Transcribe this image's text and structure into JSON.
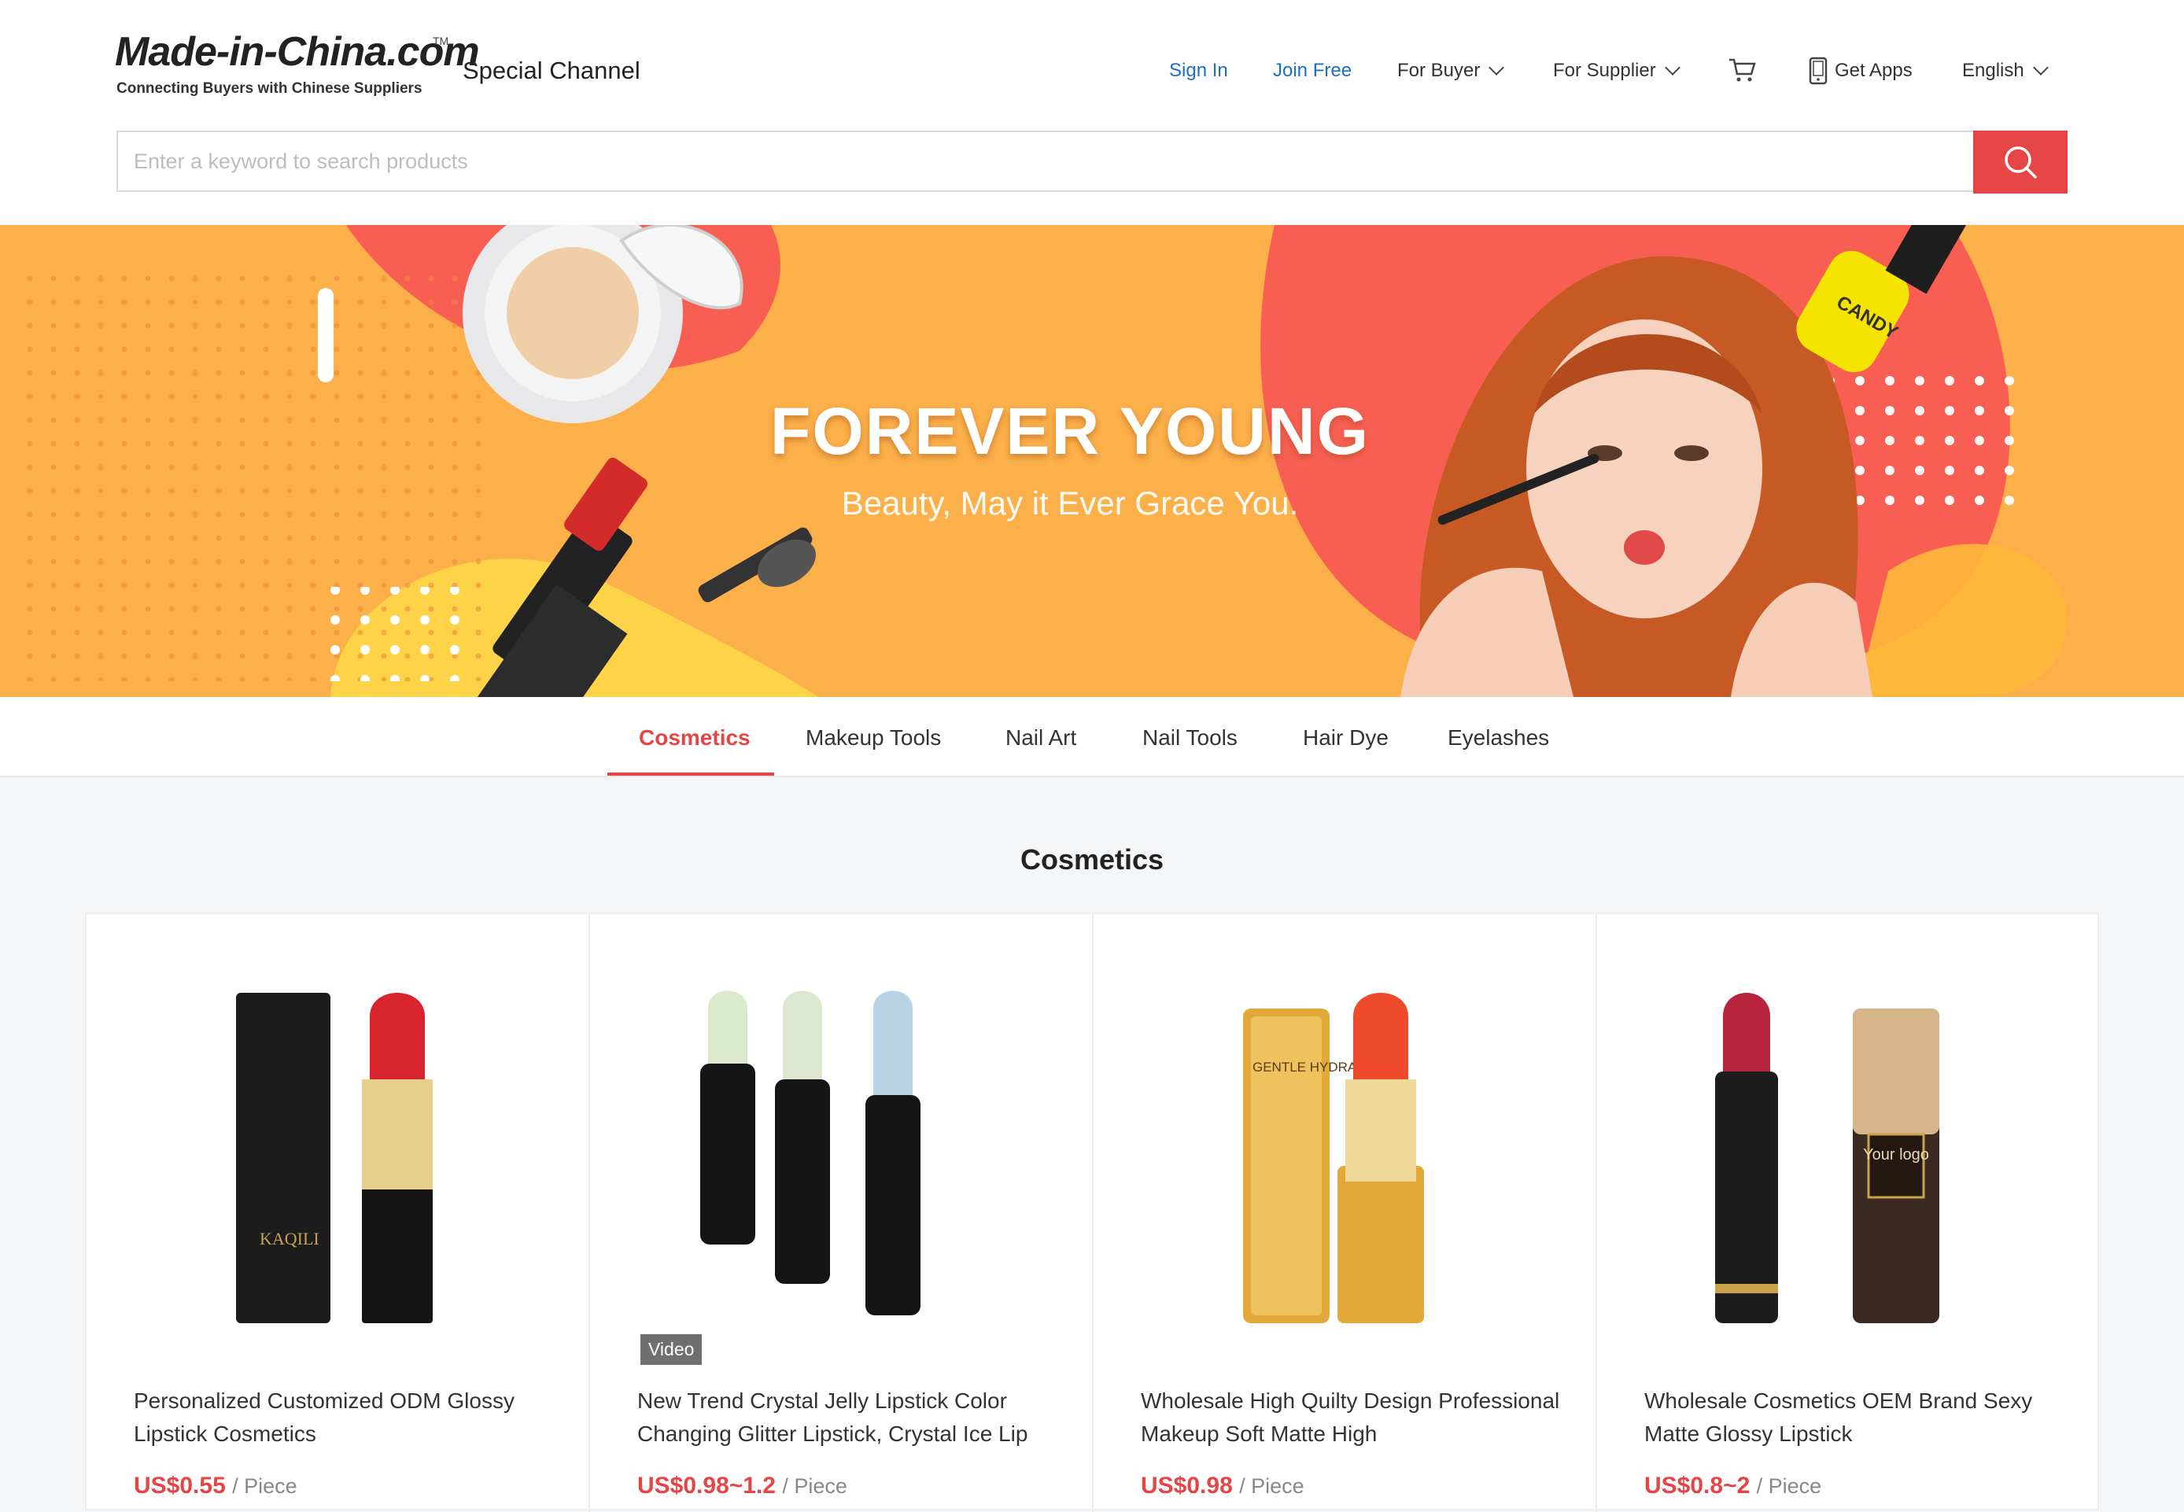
{
  "header": {
    "logo_text": "Made-in-China.com",
    "logo_tagline": "Connecting Buyers with Chinese Suppliers",
    "logo_tm": "TM",
    "channel_label": "Special Channel",
    "nav": {
      "sign_in": "Sign In",
      "join_free": "Join Free",
      "for_buyer": "For Buyer",
      "for_supplier": "For Supplier",
      "get_apps": "Get Apps",
      "language": "English"
    },
    "search_placeholder": "Enter a keyword to search products"
  },
  "banner": {
    "title": "FOREVER YOUNG",
    "subtitle": "Beauty,  May it Ever Grace You.",
    "bottle_label": "CANDY"
  },
  "tabs": [
    "Cosmetics",
    "Makeup Tools",
    "Nail Art",
    "Nail Tools",
    "Hair Dye",
    "Eyelashes"
  ],
  "active_tab": "Cosmetics",
  "section_title": "Cosmetics",
  "products": [
    {
      "title": "Personalized Customized ODM Glossy Lipstick Cosmetics",
      "price": "US$0.55",
      "unit": "/ Piece",
      "brand": "KAQILI",
      "badge": ""
    },
    {
      "title": "New Trend Crystal Jelly Lipstick Color Changing Glitter Lipstick, Crystal Ice Lip",
      "price": "US$0.98~1.2",
      "unit": "/ Piece",
      "badge": "Video"
    },
    {
      "title": "Wholesale High Quilty Design Professional Makeup Soft Matte High",
      "price": "US$0.98",
      "unit": "/ Piece",
      "brand": "GENTLE HYDRA",
      "badge": ""
    },
    {
      "title": "Wholesale Cosmetics OEM Brand Sexy Matte Glossy Lipstick",
      "price": "US$0.8~2",
      "unit": "/ Piece",
      "logo_text": "Your logo",
      "badge": ""
    }
  ],
  "colors": {
    "accent": "#e64545",
    "link": "#1b6fc7",
    "banner": "#fbb04a"
  }
}
